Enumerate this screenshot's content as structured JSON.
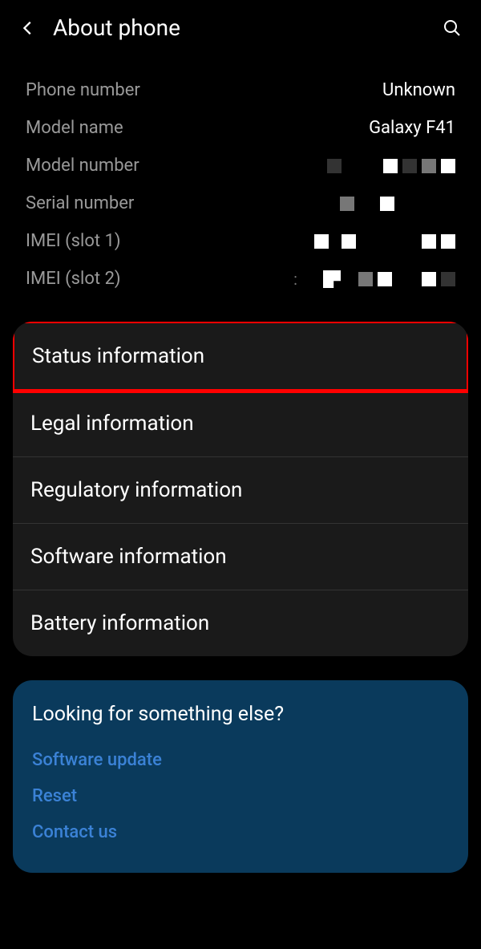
{
  "header": {
    "title": "About phone"
  },
  "info": {
    "phone_number_label": "Phone number",
    "phone_number_value": "Unknown",
    "model_name_label": "Model name",
    "model_name_value": "Galaxy F41",
    "model_number_label": "Model number",
    "serial_number_label": "Serial number",
    "imei1_label": "IMEI (slot 1)",
    "imei2_label": "IMEI (slot 2)"
  },
  "menu": {
    "status": "Status information",
    "legal": "Legal information",
    "regulatory": "Regulatory information",
    "software": "Software information",
    "battery": "Battery information"
  },
  "suggestions": {
    "title": "Looking for something else?",
    "software_update": "Software update",
    "reset": "Reset",
    "contact_us": "Contact us"
  }
}
